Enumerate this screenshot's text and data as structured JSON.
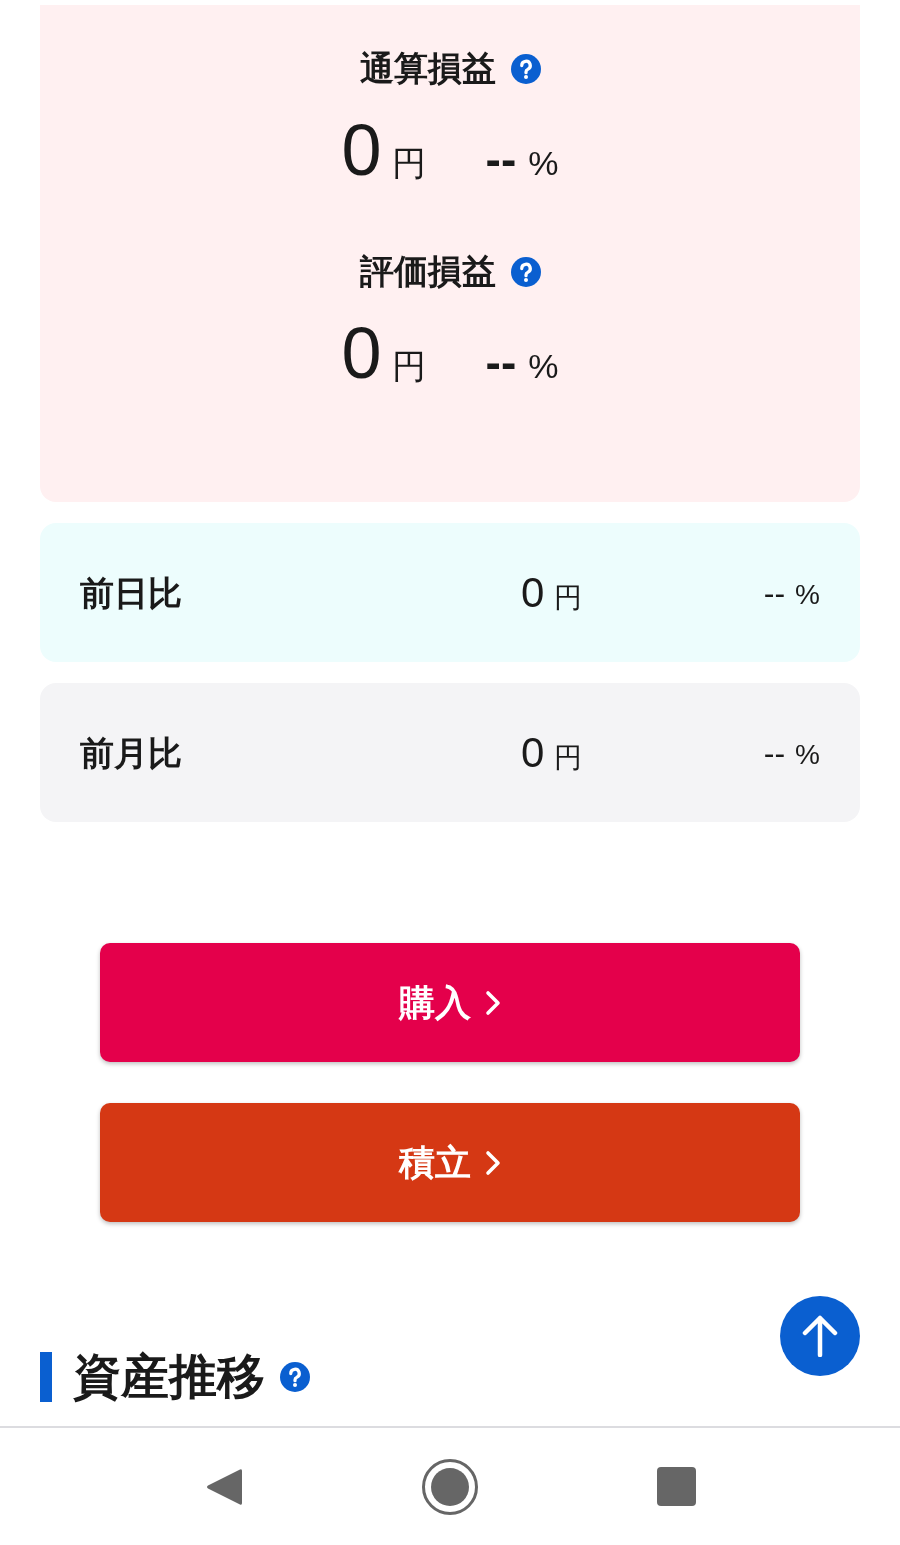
{
  "profit_panel": {
    "sections": [
      {
        "title": "通算損益",
        "amount": "0",
        "unit": "円",
        "rate": "--",
        "rate_unit": "%"
      },
      {
        "title": "評価損益",
        "amount": "0",
        "unit": "円",
        "rate": "--",
        "rate_unit": "%"
      }
    ]
  },
  "comparisons": [
    {
      "label": "前日比",
      "amount": "0",
      "unit": "円",
      "rate": "--",
      "rate_unit": "%",
      "color": "#edfdfd"
    },
    {
      "label": "前月比",
      "amount": "0",
      "unit": "円",
      "rate": "--",
      "rate_unit": "%",
      "color": "#f4f4f6"
    }
  ],
  "actions": [
    {
      "label": "購入",
      "color": "#e4004b"
    },
    {
      "label": "積立",
      "color": "#d53814"
    }
  ],
  "section_heading": {
    "title": "資産推移"
  }
}
